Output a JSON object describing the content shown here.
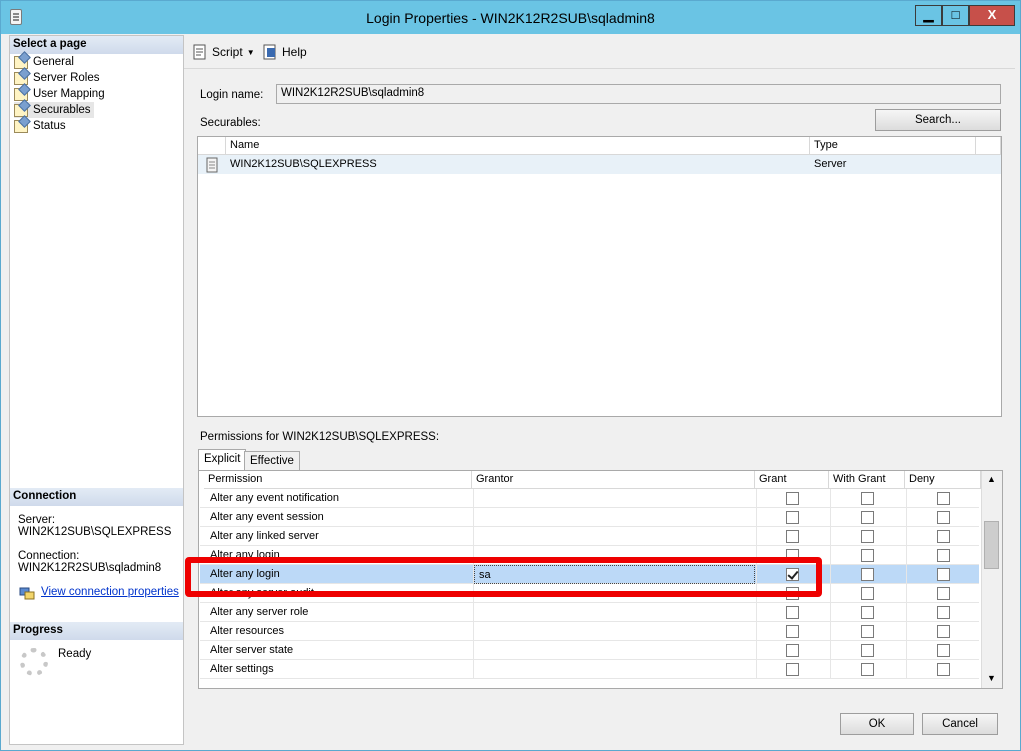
{
  "window": {
    "title": "Login Properties - WIN2K12R2SUB\\sqladmin8",
    "minimize": "▁",
    "maximize": "□",
    "close": "X"
  },
  "sidebar": {
    "select_page_heading": "Select a page",
    "pages": [
      {
        "label": "General"
      },
      {
        "label": "Server Roles"
      },
      {
        "label": "User Mapping"
      },
      {
        "label": "Securables"
      },
      {
        "label": "Status"
      }
    ],
    "connection_heading": "Connection",
    "server_label": "Server:",
    "server_value": "WIN2K12SUB\\SQLEXPRESS",
    "connection_label": "Connection:",
    "connection_value": "WIN2K12R2SUB\\sqladmin8",
    "view_connection_link": "View connection properties",
    "progress_heading": "Progress",
    "progress_status": "Ready"
  },
  "toolbar": {
    "script_label": "Script",
    "help_label": "Help"
  },
  "main": {
    "login_name_label": "Login name:",
    "login_name_value": "WIN2K12R2SUB\\sqladmin8",
    "securables_label": "Securables:",
    "search_button": "Search...",
    "securables_columns": [
      "Name",
      "Type"
    ],
    "securables_rows": [
      {
        "name": "WIN2K12SUB\\SQLEXPRESS",
        "type": "Server"
      }
    ],
    "permissions_label": "Permissions for WIN2K12SUB\\SQLEXPRESS:",
    "tabs": [
      "Explicit",
      "Effective"
    ],
    "perm_columns": [
      "Permission",
      "Grantor",
      "Grant",
      "With Grant",
      "Deny"
    ],
    "perm_rows": [
      {
        "permission": "Alter any event notification",
        "grantor": "",
        "grant": false,
        "with_grant": false,
        "deny": false
      },
      {
        "permission": "Alter any event session",
        "grantor": "",
        "grant": false,
        "with_grant": false,
        "deny": false
      },
      {
        "permission": "Alter any linked server",
        "grantor": "",
        "grant": false,
        "with_grant": false,
        "deny": false
      },
      {
        "permission": "Alter any login",
        "grantor": "",
        "grant": false,
        "with_grant": false,
        "deny": false
      },
      {
        "permission": "Alter any login",
        "grantor": "sa",
        "grant": true,
        "with_grant": false,
        "deny": false
      },
      {
        "permission": "Alter any server audit",
        "grantor": "",
        "grant": false,
        "with_grant": false,
        "deny": false
      },
      {
        "permission": "Alter any server role",
        "grantor": "",
        "grant": false,
        "with_grant": false,
        "deny": false
      },
      {
        "permission": "Alter resources",
        "grantor": "",
        "grant": false,
        "with_grant": false,
        "deny": false
      },
      {
        "permission": "Alter server state",
        "grantor": "",
        "grant": false,
        "with_grant": false,
        "deny": false
      },
      {
        "permission": "Alter settings",
        "grantor": "",
        "grant": false,
        "with_grant": false,
        "deny": false
      }
    ]
  },
  "footer": {
    "ok_button": "OK",
    "cancel_button": "Cancel"
  },
  "colors": {
    "title_bar": "#6ac4e4",
    "close_button": "#c7504a",
    "highlight_row": "#bcd9f7",
    "annotation_box": "#ee0000"
  }
}
